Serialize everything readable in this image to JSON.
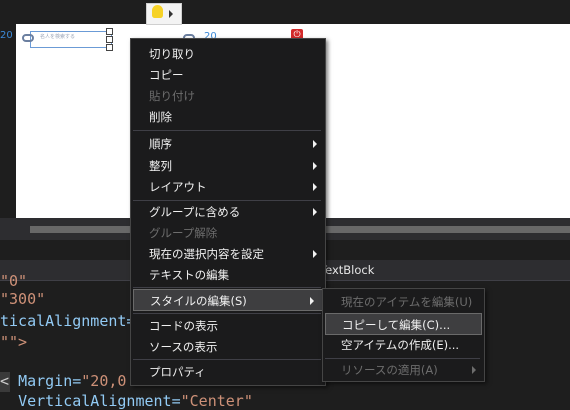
{
  "designer": {
    "ruler_left": "20",
    "ruler_right": "20",
    "textbox_placeholder": "名人を検索する",
    "power_glyph": "⏻"
  },
  "breadcrumb": "TextBlock",
  "code_lines": [
    {
      "text": "  ",
      "k": "",
      "s": "\"0\""
    },
    {
      "k": "",
      "s": "\"300\"",
      "pre": ""
    },
    {
      "k": "ticalAlignment=",
      "s": "\"C",
      "pre": ""
    },
    {
      "k": "",
      "s": "\"\">",
      "pre": ""
    },
    {
      "k": "Margin=",
      "s": "\"20,0",
      "pre": "< "
    },
    {
      "k": "VerticalAlignment=",
      "s": "\"Center\"",
      "pre": "  "
    }
  ],
  "main_menu": {
    "items": [
      {
        "label": "切り取り",
        "disabled": false,
        "submenu": false
      },
      {
        "label": "コピー",
        "disabled": false,
        "submenu": false
      },
      {
        "label": "貼り付け",
        "disabled": true,
        "submenu": false
      },
      {
        "label": "削除",
        "disabled": false,
        "submenu": false
      },
      {
        "label": "順序",
        "disabled": false,
        "submenu": true
      },
      {
        "label": "整列",
        "disabled": false,
        "submenu": true
      },
      {
        "label": "レイアウト",
        "disabled": false,
        "submenu": true
      },
      {
        "label": "グループに含める",
        "disabled": false,
        "submenu": true
      },
      {
        "label": "グループ解除",
        "disabled": true,
        "submenu": false
      },
      {
        "label": "現在の選択内容を設定",
        "disabled": false,
        "submenu": true
      },
      {
        "label": "テキストの編集",
        "disabled": false,
        "submenu": false
      },
      {
        "label": "スタイルの編集(S)",
        "disabled": false,
        "submenu": true,
        "highlighted": true
      },
      {
        "label": "コードの表示",
        "disabled": false,
        "submenu": false
      },
      {
        "label": "ソースの表示",
        "disabled": false,
        "submenu": false
      },
      {
        "label": "プロパティ",
        "disabled": false,
        "submenu": false
      }
    ]
  },
  "sub_menu": {
    "items": [
      {
        "label": "現在のアイテムを編集(U)",
        "disabled": true,
        "submenu": false
      },
      {
        "label": "コピーして編集(C)...",
        "disabled": false,
        "submenu": false,
        "highlighted": true
      },
      {
        "label": "空アイテムの作成(E)...",
        "disabled": false,
        "submenu": false
      },
      {
        "label": "リソースの適用(A)",
        "disabled": true,
        "submenu": true
      }
    ]
  }
}
